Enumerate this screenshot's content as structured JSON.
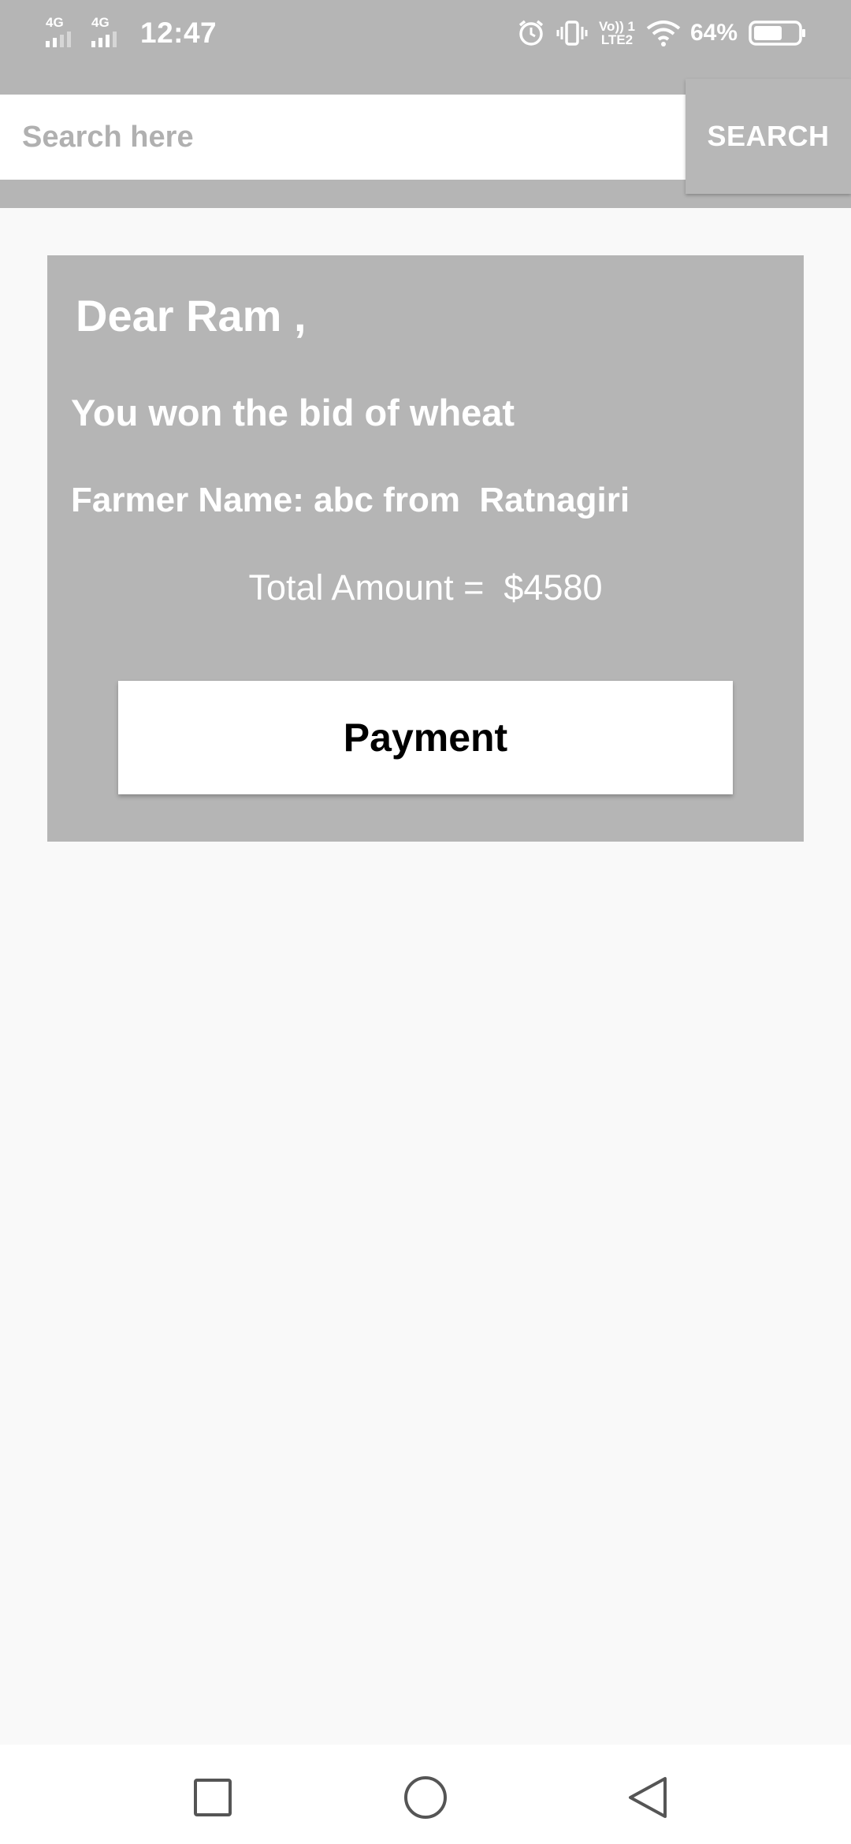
{
  "status_bar": {
    "sim1_label": "4G",
    "sim2_label": "4G",
    "time": "12:47",
    "volte_top": "Vo)) 1",
    "volte_bottom": "LTE2",
    "battery_percent": "64%",
    "battery_level": 0.64,
    "icons": [
      "signal-icon",
      "alarm-icon",
      "vibrate-icon",
      "volte-icon",
      "wifi-icon",
      "battery-icon"
    ]
  },
  "search": {
    "placeholder": "Search here",
    "value": "",
    "button_label": "SEARCH"
  },
  "card": {
    "greeting": "Dear Ram ,",
    "won_message": "You won the bid of wheat",
    "farmer_info": "Farmer Name: abc from  Ratnagiri",
    "total_amount": "Total Amount =  $4580",
    "payment_label": "Payment"
  },
  "navigation": {
    "icons": [
      "recent-apps-icon",
      "home-icon",
      "back-icon"
    ]
  },
  "colors": {
    "header_gray": "#b5b5b5",
    "card_gray": "#b5b5b5",
    "background": "#f9f9f9",
    "text_on_gray": "#ffffff"
  }
}
